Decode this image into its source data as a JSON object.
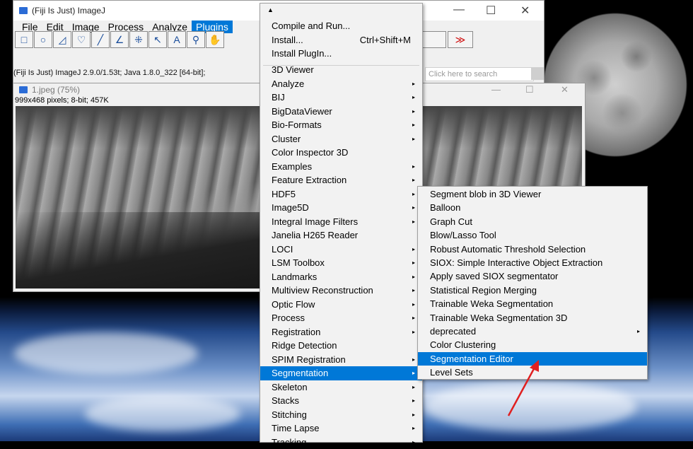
{
  "main_window": {
    "title": "(Fiji Is Just) ImageJ",
    "controls": {
      "minimize": "—",
      "maximize": "☐",
      "close": "✕"
    },
    "menus": [
      "File",
      "Edit",
      "Image",
      "Process",
      "Analyze",
      "Plugins"
    ],
    "active_menu": "Plugins",
    "status_text": "(Fiji Is Just) ImageJ 2.9.0/1.53t; Java 1.8.0_322 [64-bit];",
    "search_placeholder": "Click here to search",
    "tools": [
      {
        "name": "rectangle-tool",
        "glyph": "□"
      },
      {
        "name": "oval-tool",
        "glyph": "○"
      },
      {
        "name": "polygon-tool",
        "glyph": "◿"
      },
      {
        "name": "freehand-tool",
        "glyph": "♡"
      },
      {
        "name": "line-tool",
        "glyph": "╱"
      },
      {
        "name": "angle-tool",
        "glyph": "∠"
      },
      {
        "name": "point-tool",
        "glyph": "⁜"
      },
      {
        "name": "wand-tool",
        "glyph": "↖"
      },
      {
        "name": "text-tool",
        "glyph": "A"
      },
      {
        "name": "zoom-tool",
        "glyph": "⚲"
      },
      {
        "name": "hand-tool",
        "glyph": "✋"
      }
    ],
    "more_tools_glyph": "≫"
  },
  "image_window": {
    "title": "1.jpeg (75%)",
    "info": "999x468 pixels; 8-bit; 457K",
    "controls": {
      "minimize": "—",
      "maximize": "☐",
      "close": "✕"
    }
  },
  "plugins_menu": {
    "scroll_up": "▲",
    "top_items": [
      {
        "label": "Compile and Run...",
        "shortcut": ""
      },
      {
        "label": "Install...",
        "shortcut": "Ctrl+Shift+M"
      },
      {
        "label": "Install PlugIn...",
        "shortcut": ""
      }
    ],
    "items": [
      {
        "label": "3D Viewer",
        "submenu": false
      },
      {
        "label": "Analyze",
        "submenu": true
      },
      {
        "label": "BIJ",
        "submenu": true
      },
      {
        "label": "BigDataViewer",
        "submenu": true
      },
      {
        "label": "Bio-Formats",
        "submenu": true
      },
      {
        "label": "Cluster",
        "submenu": true
      },
      {
        "label": "Color Inspector 3D",
        "submenu": false
      },
      {
        "label": "Examples",
        "submenu": true
      },
      {
        "label": "Feature Extraction",
        "submenu": true
      },
      {
        "label": "HDF5",
        "submenu": true
      },
      {
        "label": "Image5D",
        "submenu": true
      },
      {
        "label": "Integral Image Filters",
        "submenu": true
      },
      {
        "label": "Janelia H265 Reader",
        "submenu": false
      },
      {
        "label": "LOCI",
        "submenu": true
      },
      {
        "label": "LSM Toolbox",
        "submenu": true
      },
      {
        "label": "Landmarks",
        "submenu": true
      },
      {
        "label": "Multiview Reconstruction",
        "submenu": true
      },
      {
        "label": "Optic Flow",
        "submenu": true
      },
      {
        "label": "Process",
        "submenu": true
      },
      {
        "label": "Registration",
        "submenu": true
      },
      {
        "label": "Ridge Detection",
        "submenu": false
      },
      {
        "label": "SPIM Registration",
        "submenu": true
      },
      {
        "label": "Segmentation",
        "submenu": true,
        "selected": true
      },
      {
        "label": "Skeleton",
        "submenu": true
      },
      {
        "label": "Stacks",
        "submenu": true
      },
      {
        "label": "Stitching",
        "submenu": true
      },
      {
        "label": "Time Lapse",
        "submenu": true
      },
      {
        "label": "Tracking",
        "submenu": true
      }
    ],
    "arrow_glyph": "▸"
  },
  "segmentation_menu": {
    "items": [
      {
        "label": "Segment blob in 3D Viewer",
        "submenu": false
      },
      {
        "label": "Balloon",
        "submenu": false
      },
      {
        "label": "Graph Cut",
        "submenu": false
      },
      {
        "label": "Blow/Lasso Tool",
        "submenu": false
      },
      {
        "label": "Robust Automatic Threshold Selection",
        "submenu": false
      },
      {
        "label": "SIOX: Simple Interactive Object Extraction",
        "submenu": false
      },
      {
        "label": "Apply saved SIOX segmentator",
        "submenu": false
      },
      {
        "label": "Statistical Region Merging",
        "submenu": false
      },
      {
        "label": "Trainable Weka Segmentation",
        "submenu": false
      },
      {
        "label": "Trainable Weka Segmentation 3D",
        "submenu": false
      },
      {
        "label": "deprecated",
        "submenu": true
      },
      {
        "label": "Color Clustering",
        "submenu": false
      },
      {
        "label": "Segmentation Editor",
        "submenu": false,
        "selected": true
      },
      {
        "label": "Level Sets",
        "submenu": false
      }
    ]
  },
  "colors": {
    "selection": "#0078d7",
    "annotation_arrow": "#e02020",
    "menu_bg": "#f2f2f2"
  }
}
